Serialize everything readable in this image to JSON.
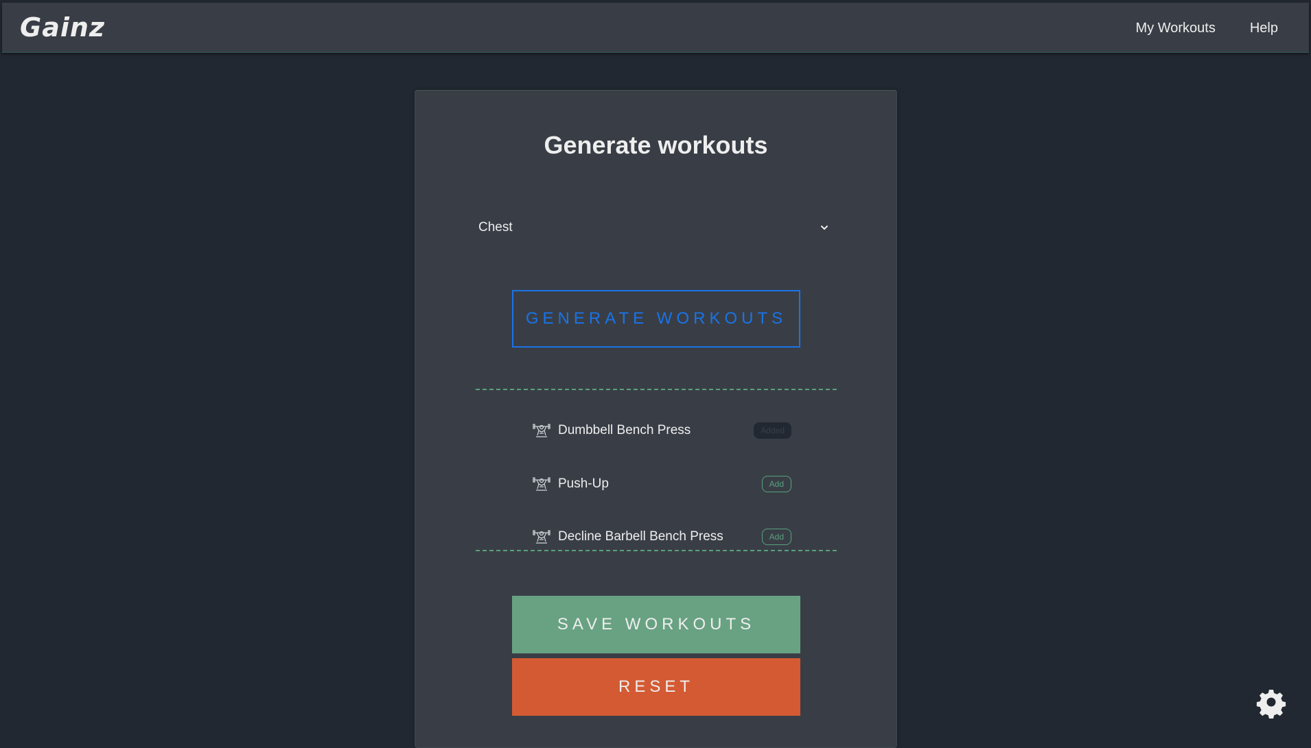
{
  "nav": {
    "brand": "Gainz",
    "links": [
      "My Workouts",
      "Help"
    ]
  },
  "card": {
    "title": "Generate workouts",
    "select_value": "Chest",
    "generate_label": "GENERATE WORKOUTS",
    "workouts": [
      {
        "name": "Dumbbell Bench Press",
        "action": "Added",
        "icon": "weightlifter-icon"
      },
      {
        "name": "Push-Up",
        "action": "Add",
        "icon": "weightlifter-icon"
      },
      {
        "name": "Decline Barbell Bench Press",
        "action": "Add",
        "icon": "weightlifter-icon"
      }
    ],
    "save_label": "SAVE WORKOUTS",
    "reset_label": "RESET"
  },
  "colors": {
    "background": "#222831",
    "panel": "#393e46",
    "accent_blue": "#1a73e8",
    "accent_green": "#68a282",
    "accent_orange": "#d45a33",
    "text": "#eeeeee"
  },
  "icons": {
    "settings": "gear-icon",
    "dropdown": "chevron-down-icon"
  }
}
